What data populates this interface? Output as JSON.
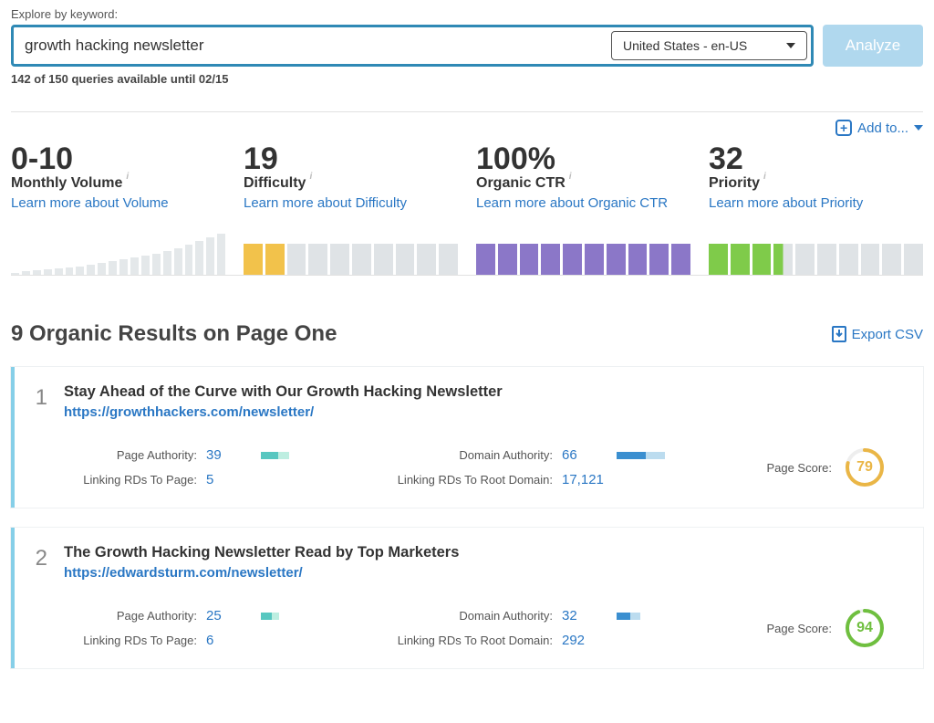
{
  "search": {
    "label": "Explore by keyword:",
    "value": "growth hacking newsletter",
    "locale": "United States - en-US",
    "analyze_label": "Analyze",
    "quota": "142 of 150 queries available until 02/15"
  },
  "addto": {
    "label": "Add to..."
  },
  "metrics": {
    "volume": {
      "value": "0-10",
      "label": "Monthly Volume",
      "learn": "Learn more about Volume"
    },
    "difficulty": {
      "value": "19",
      "label": "Difficulty",
      "learn": "Learn more about Difficulty"
    },
    "ctr": {
      "value": "100%",
      "label": "Organic CTR",
      "learn": "Learn more about Organic CTR"
    },
    "priority": {
      "value": "32",
      "label": "Priority",
      "learn": "Learn more about Priority"
    }
  },
  "chart_data": [
    {
      "type": "bar",
      "title": "Difficulty",
      "values_on": 2,
      "values_total": 10,
      "value": 19
    },
    {
      "type": "bar",
      "title": "Organic CTR",
      "values_on": 10,
      "values_total": 10,
      "value_pct": 100
    },
    {
      "type": "bar",
      "title": "Priority",
      "values_on": 3,
      "partial_fourth": true,
      "values_total": 10,
      "value": 32
    }
  ],
  "results": {
    "heading": "9 Organic Results on Page One",
    "export_label": "Export CSV",
    "labels": {
      "page_authority": "Page Authority:",
      "linking_rds_page": "Linking RDs To Page:",
      "domain_authority": "Domain Authority:",
      "linking_rds_root": "Linking RDs To Root Domain:",
      "page_score": "Page Score:"
    },
    "items": [
      {
        "rank": "1",
        "title": "Stay Ahead of the Curve with Our Growth Hacking Newsletter",
        "url": "https://growthhackers.com/newsletter/",
        "page_authority": "39",
        "linking_rds_page": "5",
        "domain_authority": "66",
        "linking_rds_root": "17,121",
        "page_score": "79",
        "score_color": "#eab646"
      },
      {
        "rank": "2",
        "title": "The Growth Hacking Newsletter Read by Top Marketers",
        "url": "https://edwardsturm.com/newsletter/",
        "page_authority": "25",
        "linking_rds_page": "6",
        "domain_authority": "32",
        "linking_rds_root": "292",
        "page_score": "94",
        "score_color": "#6fbf3f"
      }
    ]
  }
}
